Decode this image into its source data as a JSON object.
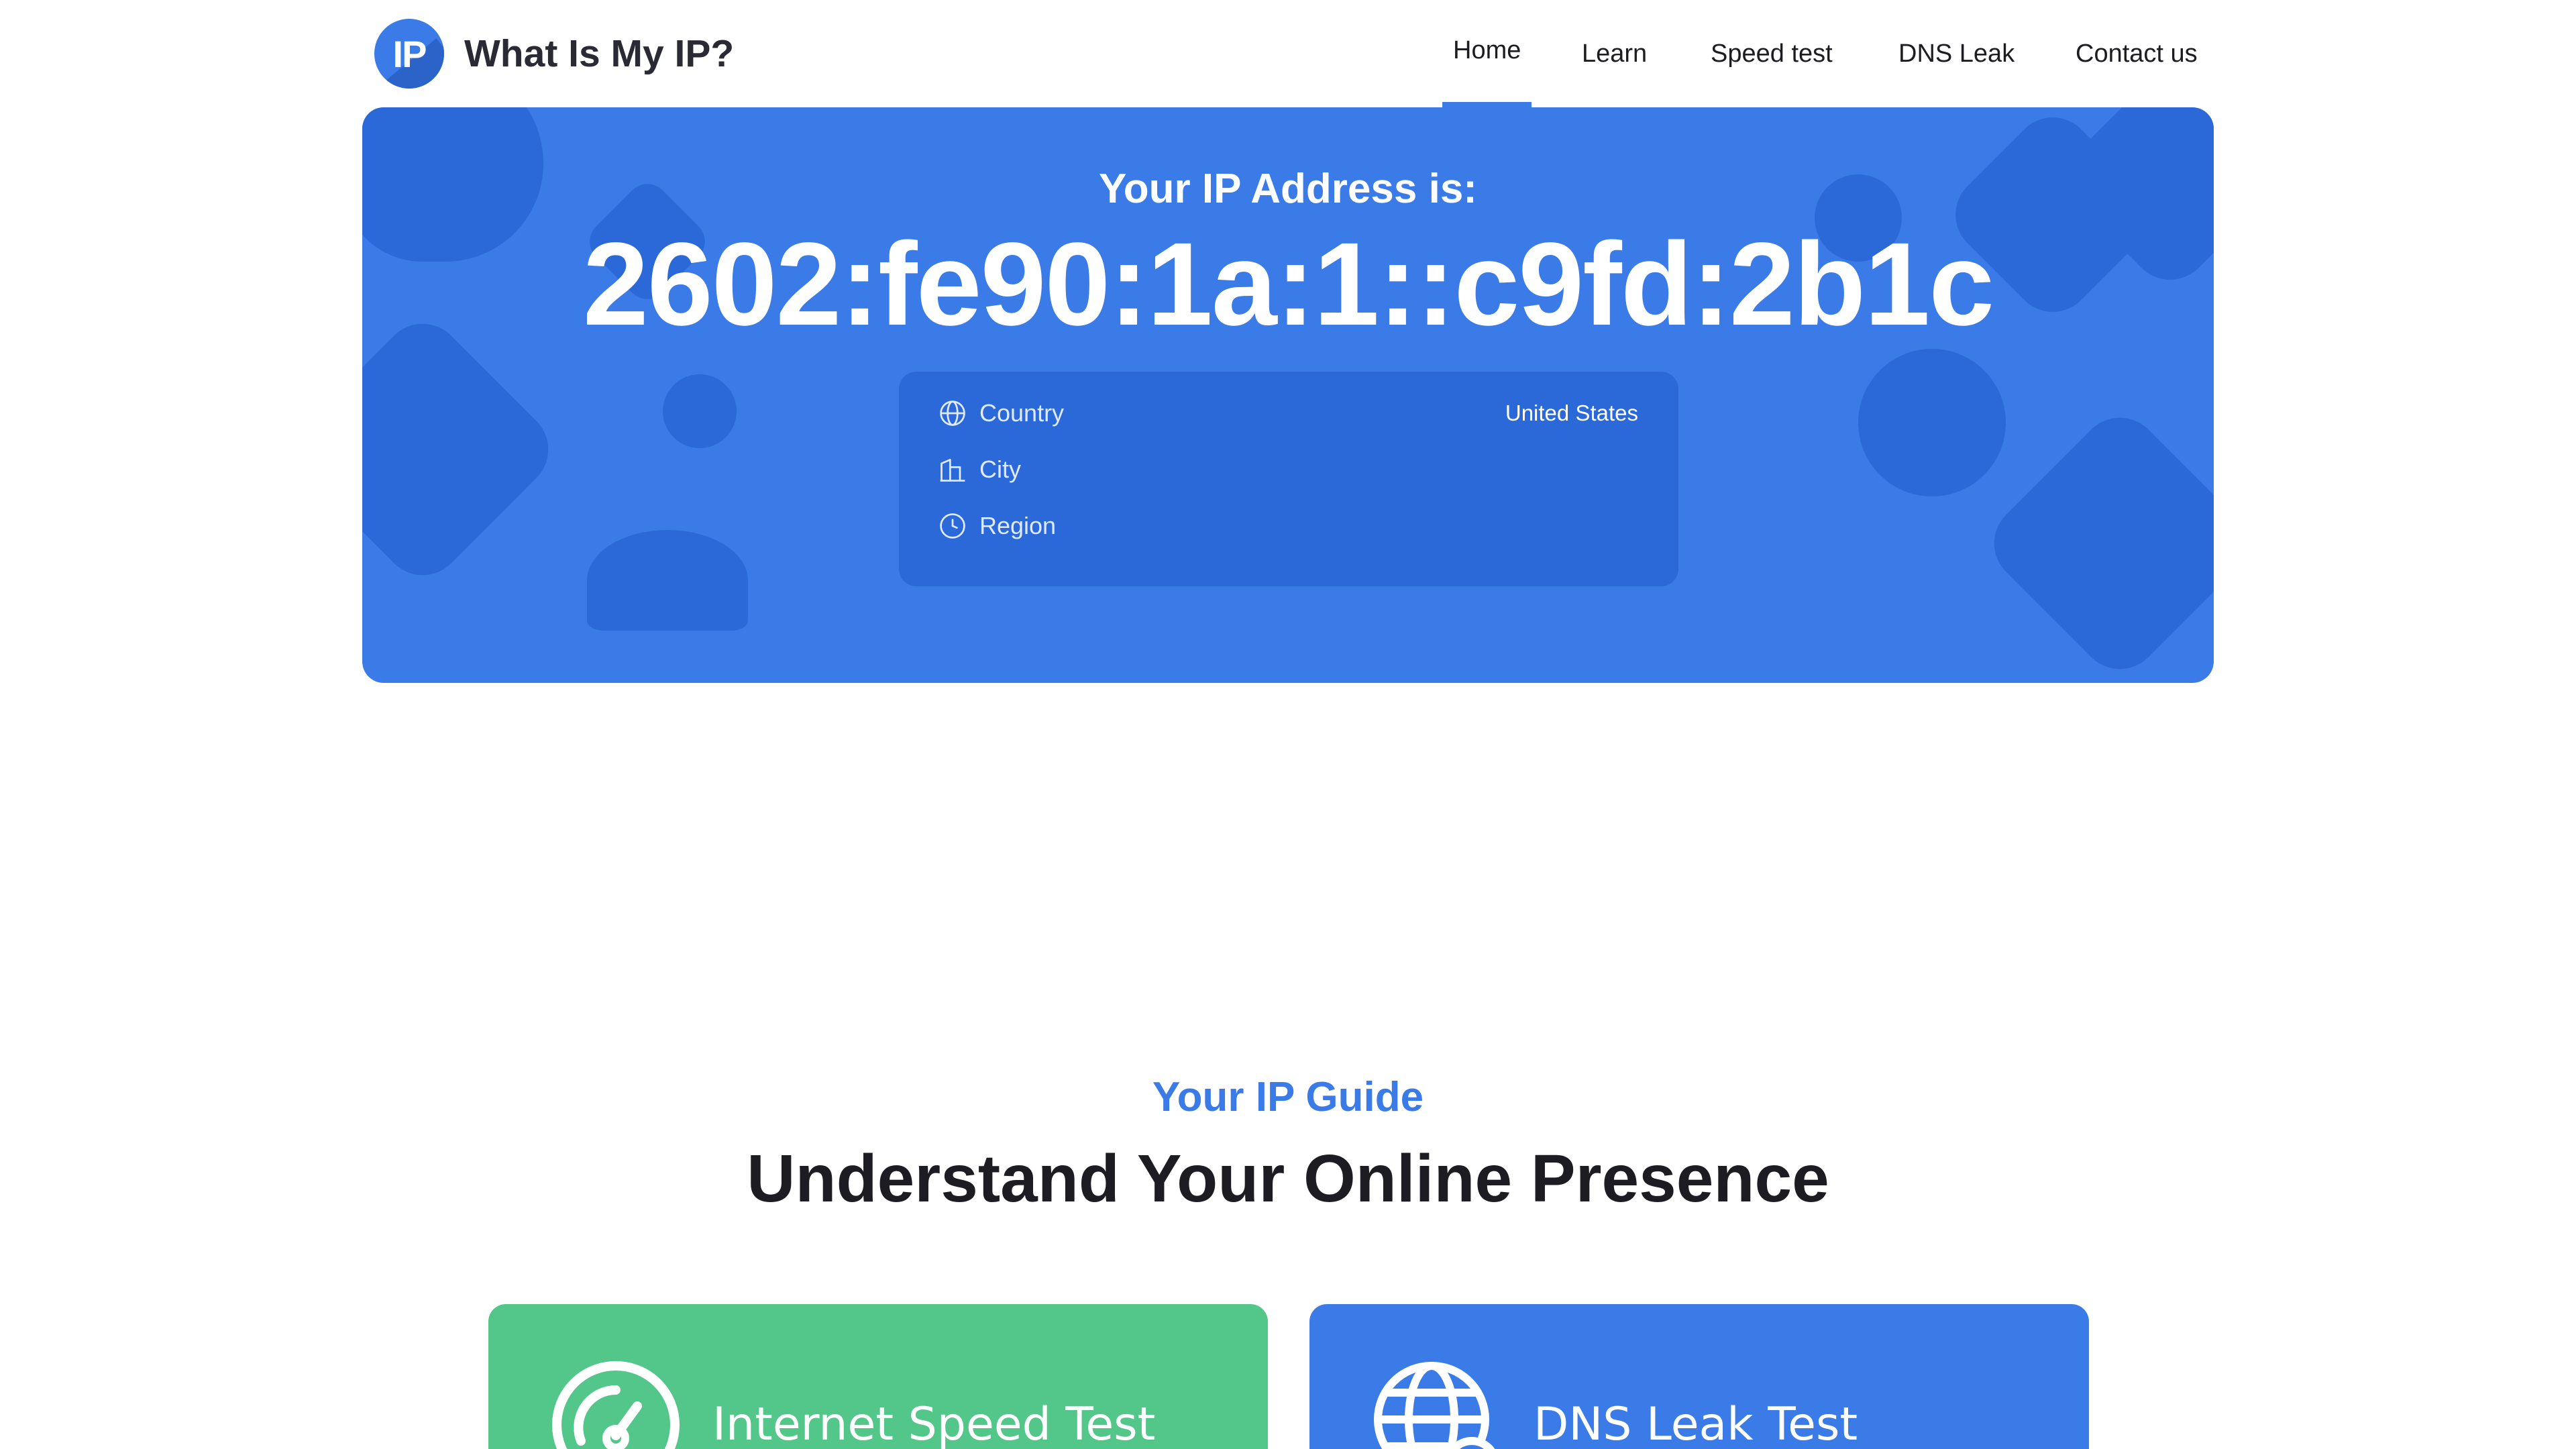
{
  "header": {
    "logo_badge": "IP",
    "logo_text": "What Is My IP?",
    "nav": [
      {
        "label": "Home",
        "active": true
      },
      {
        "label": "Learn"
      },
      {
        "label": "Speed test"
      },
      {
        "label": "DNS Leak"
      },
      {
        "label": "Contact us"
      }
    ]
  },
  "hero": {
    "label": "Your IP Address is:",
    "ip": "2602:fe90:1a:1::c9fd:2b1c",
    "info": {
      "country_label": "Country",
      "country_value": "United States",
      "city_label": "City",
      "city_value": "",
      "region_label": "Region",
      "region_value": ""
    }
  },
  "guide": {
    "kicker": "Your IP Guide",
    "title": "Understand Your Online Presence",
    "cards": [
      {
        "label": "Internet Speed Test",
        "icon": "speedometer-icon",
        "color": "#53c689"
      },
      {
        "label": "DNS Leak Test",
        "icon": "globe-icon",
        "color": "#3a7be8"
      }
    ]
  },
  "colors": {
    "accent": "#3a7be8",
    "accent_dark": "#2b69d8",
    "green": "#53c689"
  }
}
